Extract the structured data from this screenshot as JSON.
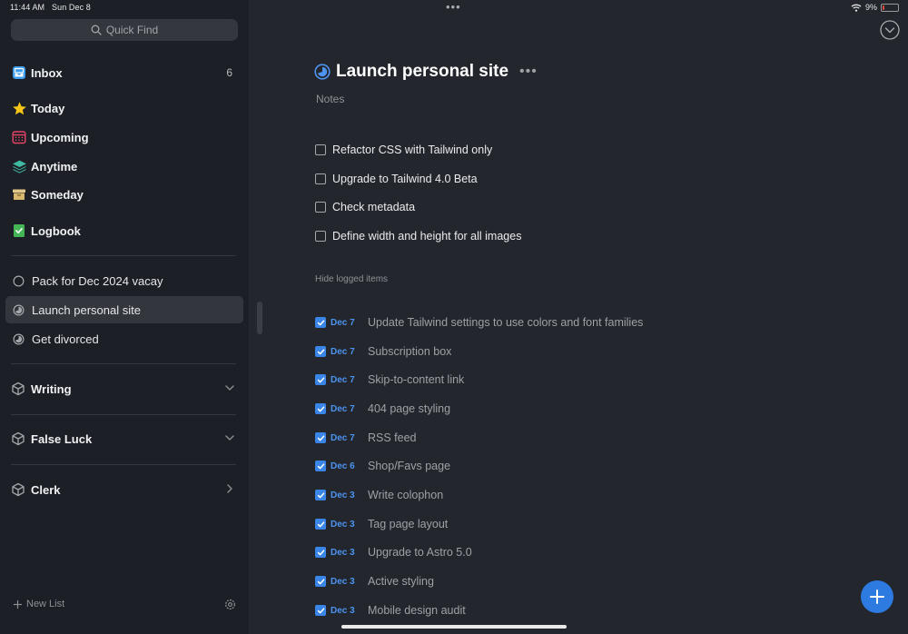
{
  "status": {
    "time": "11:44 AM",
    "date": "Sun Dec 8",
    "battery": "9%"
  },
  "search": {
    "placeholder": "Quick Find"
  },
  "nav": {
    "inbox": {
      "label": "Inbox",
      "count": "6"
    },
    "today": "Today",
    "upcoming": "Upcoming",
    "anytime": "Anytime",
    "someday": "Someday",
    "logbook": "Logbook"
  },
  "projects": [
    {
      "label": "Pack for Dec 2024 vacay"
    },
    {
      "label": "Launch personal site"
    },
    {
      "label": "Get divorced"
    }
  ],
  "areas": [
    {
      "label": "Writing",
      "state": "expanded"
    },
    {
      "label": "False Luck",
      "state": "expanded"
    },
    {
      "label": "Clerk",
      "state": "collapsed"
    }
  ],
  "footer": {
    "new_list": "New List"
  },
  "main": {
    "title": "Launch personal site",
    "notes_placeholder": "Notes",
    "hide_logged": "Hide logged items",
    "tasks": [
      "Refactor CSS with Tailwind only",
      "Upgrade to Tailwind 4.0 Beta",
      "Check metadata",
      "Define width and height for all images"
    ],
    "logged": [
      {
        "date": "Dec 7",
        "text": "Update Tailwind settings to use colors and font families"
      },
      {
        "date": "Dec 7",
        "text": "Subscription box"
      },
      {
        "date": "Dec 7",
        "text": "Skip-to-content link"
      },
      {
        "date": "Dec 7",
        "text": "404 page styling"
      },
      {
        "date": "Dec 7",
        "text": "RSS feed"
      },
      {
        "date": "Dec 6",
        "text": "Shop/Favs page"
      },
      {
        "date": "Dec 3",
        "text": "Write colophon"
      },
      {
        "date": "Dec 3",
        "text": "Tag page layout"
      },
      {
        "date": "Dec 3",
        "text": "Upgrade to Astro 5.0"
      },
      {
        "date": "Dec 3",
        "text": "Active styling"
      },
      {
        "date": "Dec 3",
        "text": "Mobile design audit"
      }
    ]
  },
  "colors": {
    "accent": "#3a86e8",
    "background": "#23262d",
    "sidebar": "#1c1f25"
  }
}
